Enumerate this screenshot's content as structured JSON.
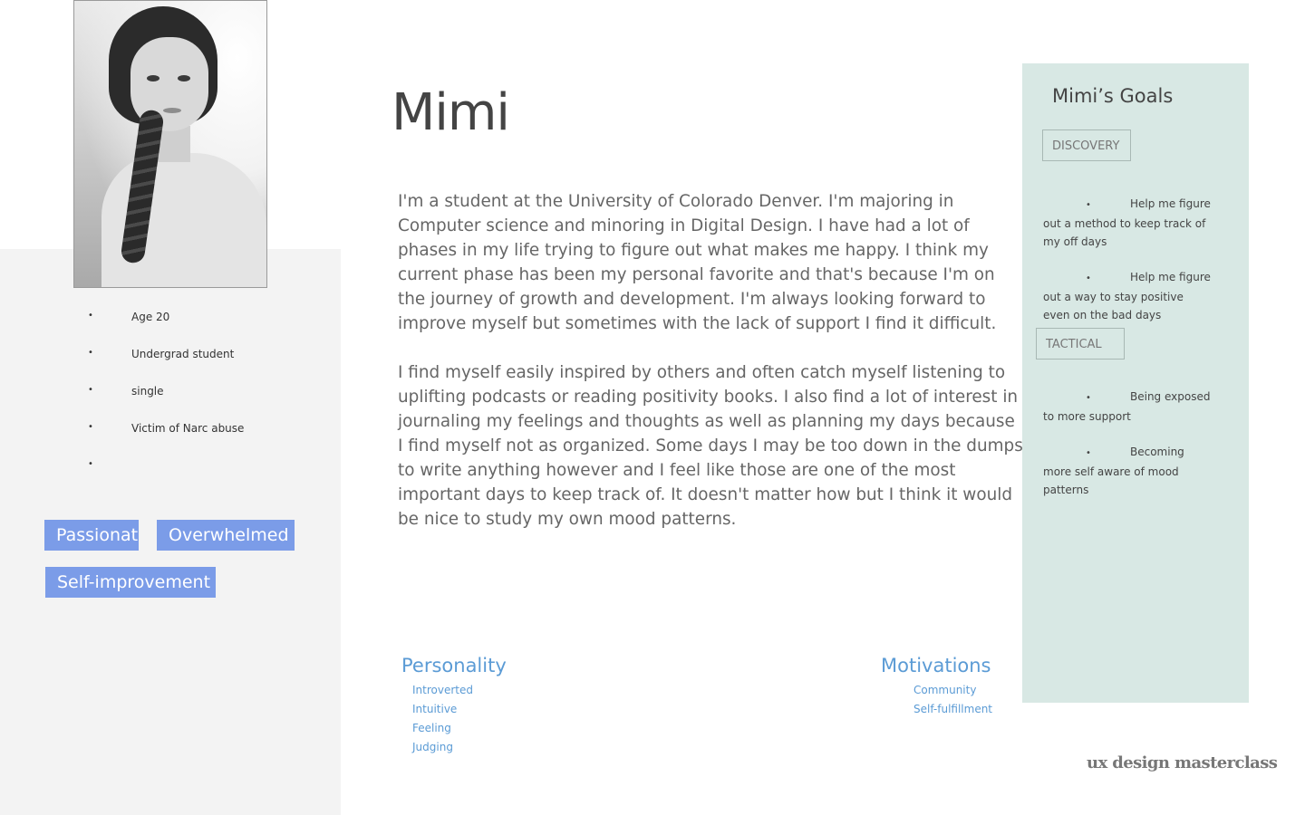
{
  "persona": {
    "name": "Mimi",
    "facts": [
      "Age 20",
      "Undergrad student",
      "single",
      "Victim of Narc abuse",
      ""
    ],
    "tags": [
      "Passionate",
      "Overwhelmed",
      "Self-improvement"
    ],
    "bio": [
      "I'm a student at the University of Colorado Denver. I'm majoring in Computer science and minoring in Digital Design. I have had a lot of phases in my life trying to figure out what makes me happy. I think my current phase has been my personal favorite and that's because I'm on the journey of growth and development. I'm always looking forward to improve myself but sometimes with the lack of support I find it difficult.",
      "I find myself easily inspired by others and often catch myself listening to uplifting podcasts or reading positivity books. I also find a lot of interest in journaling my feelings and thoughts as well as planning my days because I find myself not as organized. Some days I may be too down in the dumps to write anything however and I feel like those are one of the most important days to keep track of. It doesn't matter how but I think it would be nice to study my own mood patterns."
    ]
  },
  "personality": {
    "title": "Personality",
    "items": [
      "Introverted",
      "Intuitive",
      "Feeling",
      "Judging"
    ]
  },
  "motivations": {
    "title": "Motivations",
    "items": [
      "Community",
      "Self-fulfillment"
    ]
  },
  "goals": {
    "title": "Mimi’s Goals",
    "discovery": {
      "label": "DISCOVERY",
      "items": [
        "Help me figure out a method to keep track of my off days",
        "Help me figure out a way to stay positive even on the bad days"
      ]
    },
    "tactical": {
      "label": "TACTICAL",
      "items": [
        "Being exposed to more support",
        "Becoming more self aware of mood patterns"
      ]
    }
  },
  "footer": {
    "logo_text": "ux design masterclass"
  },
  "icons": {
    "bullet": "•"
  },
  "colors": {
    "tag_bg": "#7b9ce8",
    "accent_blue": "#5b9bd5",
    "goals_bg": "#d8e8e4",
    "left_panel_bg": "#f3f3f3"
  }
}
